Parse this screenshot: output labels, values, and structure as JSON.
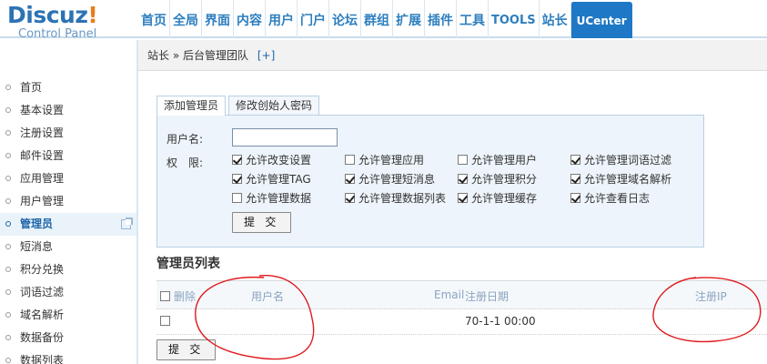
{
  "logo": {
    "brand": "Discuz",
    "bang": "!",
    "sub": "Control Panel"
  },
  "nav": [
    {
      "label": "首页"
    },
    {
      "label": "全局"
    },
    {
      "label": "界面"
    },
    {
      "label": "内容"
    },
    {
      "label": "用户"
    },
    {
      "label": "门户"
    },
    {
      "label": "论坛"
    },
    {
      "label": "群组"
    },
    {
      "label": "扩展"
    },
    {
      "label": "插件"
    },
    {
      "label": "工具"
    },
    {
      "label": "TOOLS"
    },
    {
      "label": "站长"
    },
    {
      "label": "UCenter"
    }
  ],
  "sidebar": {
    "items": [
      {
        "label": "首页"
      },
      {
        "label": "基本设置"
      },
      {
        "label": "注册设置"
      },
      {
        "label": "邮件设置"
      },
      {
        "label": "应用管理"
      },
      {
        "label": "用户管理"
      },
      {
        "label": "管理员"
      },
      {
        "label": "短消息"
      },
      {
        "label": "积分兑换"
      },
      {
        "label": "词语过滤"
      },
      {
        "label": "域名解析"
      },
      {
        "label": "数据备份"
      },
      {
        "label": "数据列表"
      }
    ]
  },
  "breadcrumb": {
    "root": "站长",
    "sep": " » ",
    "current": "后台管理团队",
    "plus": "[+]"
  },
  "tabs": [
    {
      "label": "添加管理员"
    },
    {
      "label": "修改创始人密码"
    }
  ],
  "form": {
    "username_label": "用户名:",
    "username_value": "",
    "perm_label": "权　限:",
    "permissions": [
      {
        "label": "允许改变设置",
        "checked": true
      },
      {
        "label": "允许管理应用",
        "checked": false
      },
      {
        "label": "允许管理用户",
        "checked": false
      },
      {
        "label": "允许管理词语过滤",
        "checked": true
      },
      {
        "label": "允许管理TAG",
        "checked": true
      },
      {
        "label": "允许管理短消息",
        "checked": true
      },
      {
        "label": "允许管理积分",
        "checked": true
      },
      {
        "label": "允许管理域名解析",
        "checked": true
      },
      {
        "label": "允许管理数据",
        "checked": false
      },
      {
        "label": "允许管理数据列表",
        "checked": true
      },
      {
        "label": "允许管理缓存",
        "checked": true
      },
      {
        "label": "允许查看日志",
        "checked": true
      }
    ],
    "submit_label": "提 交"
  },
  "list": {
    "title": "管理员列表",
    "headers": {
      "delete": "删除",
      "username": "用户名",
      "email": "Email",
      "regdate": "注册日期",
      "regip": "注册IP"
    },
    "rows": [
      {
        "username": "",
        "email": "",
        "regdate": "70-1-1 00:00",
        "regip": ""
      }
    ],
    "submit_label": "提 交"
  },
  "colors": {
    "accent": "#1f78c5",
    "nav_text": "#2e7fbf",
    "annotation": "#e0191d"
  }
}
